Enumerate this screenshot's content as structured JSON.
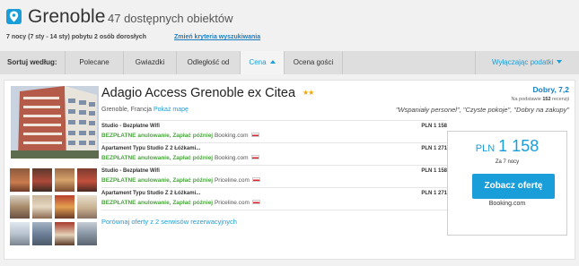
{
  "header": {
    "city": "Grenoble",
    "count": "47 dostępnych obiektów",
    "trip": "7 nocy (7 sty - 14 sty) pobytu 2 osób dorosłych",
    "change_link": "Zmień kryteria wyszukiwania"
  },
  "sortbar": {
    "label": "Sortuj według:",
    "options": [
      "Polecane",
      "Gwiazdki",
      "Odległość od",
      "Cena",
      "Ocena gości"
    ],
    "active": "Cena",
    "filter": "Wyłączając podatki"
  },
  "hotel": {
    "name": "Adagio Access Grenoble ex Citea",
    "stars": "★★",
    "location": "Grenoble, Francja",
    "map_link": "Pokaż mapę",
    "rating": "Dobry, 7,2",
    "reviews_prefix": "Na podstawie",
    "reviews_count": "152",
    "reviews_suffix": "recenzji",
    "quotes": "\"Wspaniały personel\", \"Czyste pokoje\", \"Dobry na zakupy\"",
    "offers": [
      {
        "name": "Studio - Bezpłatne Wifi",
        "free": "BEZPŁATNE anulowanie, Zapłać później",
        "provider": "Booking.com",
        "price": "PLN 1 158"
      },
      {
        "name": "Apartament Typu Studio Z 2 Łóżkami...",
        "free": "BEZPŁATNE anulowanie, Zapłać później",
        "provider": "Booking.com",
        "price": "PLN 1 271"
      },
      {
        "name": "Studio - Bezpłatne Wifi",
        "free": "BEZPŁATNE anulowanie, Zapłać później",
        "provider": "Priceline.com",
        "price": "PLN 1 158"
      },
      {
        "name": "Apartament Typu Studio Z 2 Łóżkami...",
        "free": "BEZPŁATNE anulowanie, Zapłać później",
        "provider": "Priceline.com",
        "price": "PLN 1 271"
      }
    ],
    "compare": "Porównaj oferty z 2 serwisów rezerwacyjnych",
    "price_box": {
      "currency": "PLN",
      "amount": "1 158",
      "nights": "Za 7 nocy",
      "cta": "Zobacz ofertę",
      "source": "Booking.com"
    }
  },
  "colors": {
    "accent": "#1a9ed9",
    "free_green": "#49a43c",
    "star": "#f3a800"
  }
}
